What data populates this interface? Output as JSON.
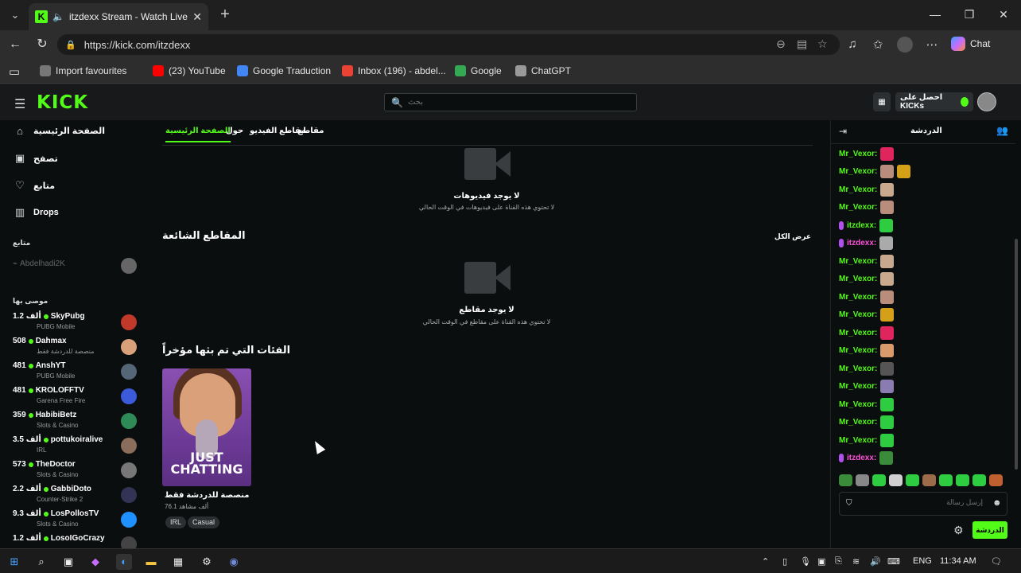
{
  "browser": {
    "tab_title": "itzdexx Stream - Watch Live o",
    "url": "https://kick.com/itzdexx",
    "copilot_label": "Chat",
    "bookmarks": [
      {
        "label": "Import favourites",
        "color": "#777777"
      },
      {
        "label": "(23) YouTube",
        "color": "#ff0000"
      },
      {
        "label": "Google Traduction",
        "color": "#4285f4"
      },
      {
        "label": "Inbox (196) - abdel...",
        "color": "#ea4335"
      },
      {
        "label": "Google",
        "color": "#34a853"
      },
      {
        "label": "ChatGPT",
        "color": "#999999"
      }
    ]
  },
  "kick": {
    "logo": "KICK",
    "search_placeholder": "بحث",
    "get_kicks_label": "احصل على KICKs",
    "accent": "#53fc18"
  },
  "sidebar": {
    "nav": [
      {
        "label": "الصفحة الرئيسية",
        "icon": "home-icon"
      },
      {
        "label": "تصفح",
        "icon": "browse-icon"
      },
      {
        "label": "متابع",
        "icon": "heart-icon"
      },
      {
        "label": "Drops",
        "icon": "drops-icon"
      }
    ],
    "following_title": "متابع",
    "following_user": "Abdelhadi2K",
    "recommended_title": "موصى بها",
    "recommended": [
      {
        "name": "SkyPubg",
        "count": "1.2 ألف",
        "category": "PUBG Mobile",
        "color": "#c0392b"
      },
      {
        "name": "Dahmax",
        "count": "508",
        "category": "منصصة للدردشة فقط",
        "color": "#d9a07a"
      },
      {
        "name": "AnshYT",
        "count": "481",
        "category": "PUBG Mobile",
        "color": "#556677"
      },
      {
        "name": "KROLOFFTV",
        "count": "481",
        "category": "Garena Free Fire",
        "color": "#3b5bdb"
      },
      {
        "name": "HabibiBetz",
        "count": "359",
        "category": "Slots & Casino",
        "color": "#2e8b57"
      },
      {
        "name": "pottukoiralive",
        "count": "3.5 ألف",
        "category": "IRL",
        "color": "#8a6d5a"
      },
      {
        "name": "TheDoctor",
        "count": "573",
        "category": "Slots & Casino",
        "color": "#777777"
      },
      {
        "name": "GabbiDoto",
        "count": "2.2 ألف",
        "category": "Counter-Strike 2",
        "color": "#333355"
      },
      {
        "name": "LosPollosTV",
        "count": "9.3 ألف",
        "category": "Slots & Casino",
        "color": "#1e90ff"
      },
      {
        "name": "LosoIGoCrazy",
        "count": "1.2 ألف",
        "category": "",
        "color": "#444444"
      }
    ]
  },
  "channel": {
    "tabs": [
      "الصفحة الرئيسية",
      "حول",
      "مقاطع الفيديو",
      "مقاطع"
    ],
    "no_videos_title": "لا يوجد فيديوهات",
    "no_videos_sub": "لا تحتوي هذه القناة على فيديوهات في الوقت الحالي",
    "clips_title": "المقاطع الشائعة",
    "view_all": "عرض الكل",
    "no_clips_title": "لا يوجد مقاطع",
    "no_clips_sub": "لا تحتوي هذه القناة على مقاطع في الوقت الحالي",
    "recent_cats_title": "الفئات التي تم بثها مؤخراً",
    "category": {
      "card_text": "JUST CHATTING",
      "name": "منصصة للدردشة فقط",
      "viewers": "76.1",
      "viewers_unit": "ألف مشاهد",
      "tags": [
        "IRL",
        "Casual"
      ]
    }
  },
  "chat": {
    "title": "الدردشة",
    "messages": [
      {
        "user": "Mr_Vexor:",
        "color": "#53fc18",
        "badge": false,
        "emotes": [
          "#e0245e"
        ]
      },
      {
        "user": "Mr_Vexor:",
        "color": "#53fc18",
        "badge": false,
        "emotes": [
          "#b98d7c",
          "#d4a017"
        ]
      },
      {
        "user": "Mr_Vexor:",
        "color": "#53fc18",
        "badge": false,
        "emotes": [
          "#c8a98e"
        ]
      },
      {
        "user": "Mr_Vexor:",
        "color": "#53fc18",
        "badge": false,
        "emotes": [
          "#b98d7c"
        ]
      },
      {
        "user": "itzdexx:",
        "color": "#53fc18",
        "badge": true,
        "emotes": [
          "#2ecc40"
        ]
      },
      {
        "user": "itzdexx:",
        "color": "#ff4fd8",
        "badge": true,
        "emotes": [
          "#aaaaaa"
        ]
      },
      {
        "user": "Mr_Vexor:",
        "color": "#53fc18",
        "badge": false,
        "emotes": [
          "#c8a98e"
        ]
      },
      {
        "user": "Mr_Vexor:",
        "color": "#53fc18",
        "badge": false,
        "emotes": [
          "#c8a98e"
        ]
      },
      {
        "user": "Mr_Vexor:",
        "color": "#53fc18",
        "badge": false,
        "emotes": [
          "#b98d7c"
        ]
      },
      {
        "user": "Mr_Vexor:",
        "color": "#53fc18",
        "badge": false,
        "emotes": [
          "#d4a017"
        ]
      },
      {
        "user": "Mr_Vexor:",
        "color": "#53fc18",
        "badge": false,
        "emotes": [
          "#e0245e"
        ]
      },
      {
        "user": "Mr_Vexor:",
        "color": "#53fc18",
        "badge": false,
        "emotes": [
          "#d99a6c"
        ]
      },
      {
        "user": "Mr_Vexor:",
        "color": "#53fc18",
        "badge": false,
        "emotes": [
          "#555555"
        ]
      },
      {
        "user": "Mr_Vexor:",
        "color": "#53fc18",
        "badge": false,
        "emotes": [
          "#8a7bb0"
        ]
      },
      {
        "user": "Mr_Vexor:",
        "color": "#53fc18",
        "badge": false,
        "emotes": [
          "#2ecc40"
        ]
      },
      {
        "user": "Mr_Vexor:",
        "color": "#53fc18",
        "badge": false,
        "emotes": [
          "#2ecc40"
        ]
      },
      {
        "user": "Mr_Vexor:",
        "color": "#53fc18",
        "badge": false,
        "emotes": [
          "#2ecc40"
        ]
      },
      {
        "user": "itzdexx:",
        "color": "#ff4fd8",
        "badge": true,
        "emotes": [
          "#3a8c3a"
        ]
      }
    ],
    "input_placeholder": "إرسل رسالة",
    "send_label": "الدردشة"
  },
  "taskbar": {
    "lang": "ENG",
    "time": "11:34 AM"
  }
}
